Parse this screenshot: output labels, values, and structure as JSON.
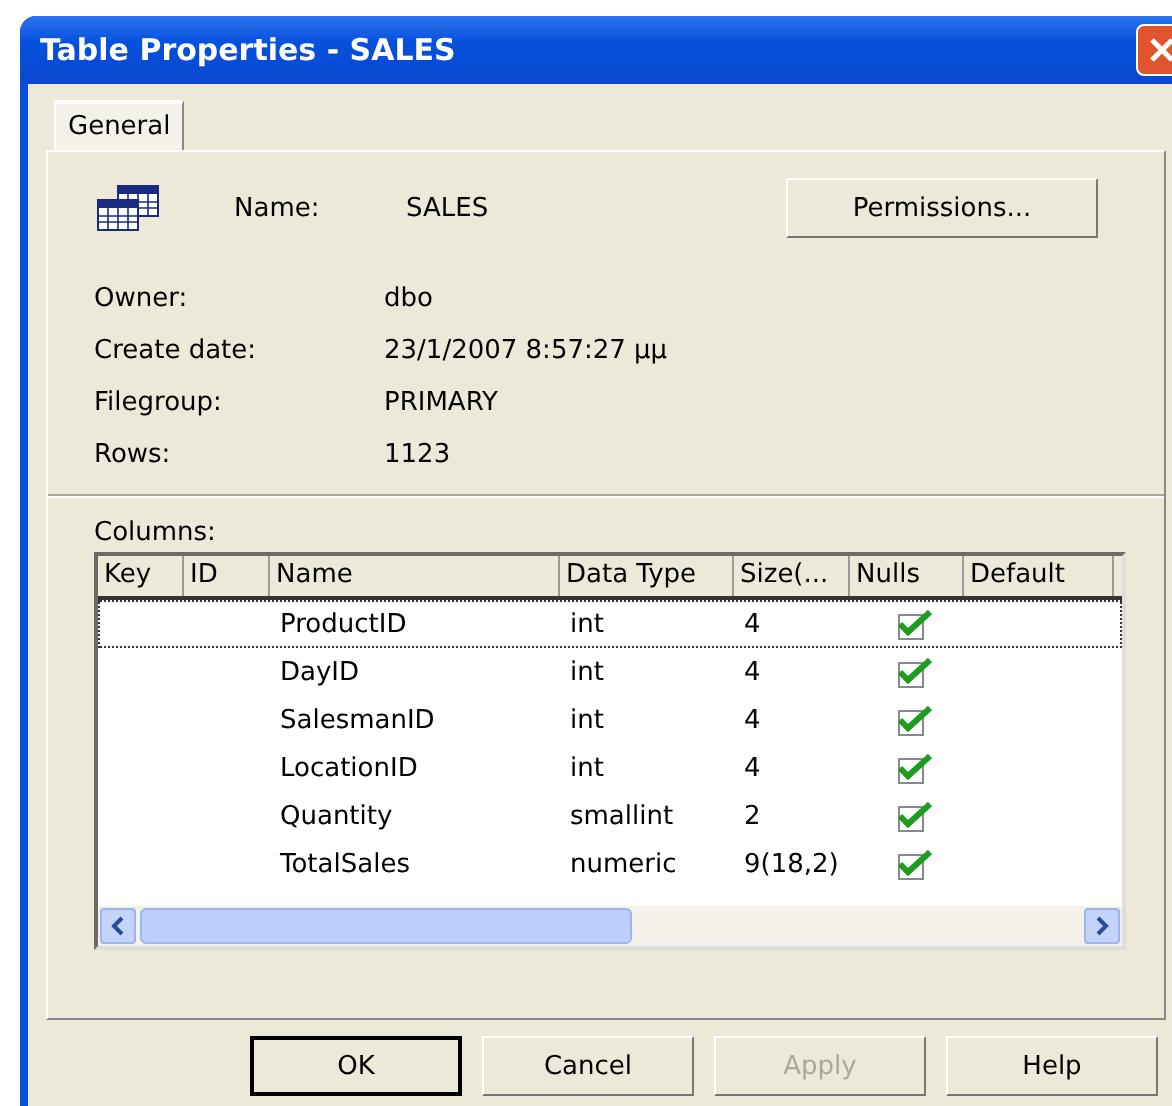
{
  "window": {
    "title": "Table Properties - SALES"
  },
  "tabs": [
    {
      "label": "General",
      "selected": true
    }
  ],
  "name": {
    "label": "Name:",
    "value": "SALES"
  },
  "permissions_button": {
    "label": "Permissions..."
  },
  "properties": [
    {
      "label": "Owner:",
      "value": "dbo"
    },
    {
      "label": "Create date:",
      "value": "23/1/2007 8:57:27 μμ"
    },
    {
      "label": "Filegroup:",
      "value": "PRIMARY"
    },
    {
      "label": "Rows:",
      "value": "1123"
    }
  ],
  "columns_label": "Columns:",
  "table": {
    "columns": [
      "Key",
      "ID",
      "Name",
      "Data Type",
      "Size(...",
      "Nulls",
      "Default"
    ],
    "rows": [
      {
        "name": "ProductID",
        "data_type": "int",
        "size": "4",
        "nulls": true,
        "selected": true
      },
      {
        "name": "DayID",
        "data_type": "int",
        "size": "4",
        "nulls": true,
        "selected": false
      },
      {
        "name": "SalesmanID",
        "data_type": "int",
        "size": "4",
        "nulls": true,
        "selected": false
      },
      {
        "name": "LocationID",
        "data_type": "int",
        "size": "4",
        "nulls": true,
        "selected": false
      },
      {
        "name": "Quantity",
        "data_type": "smallint",
        "size": "2",
        "nulls": true,
        "selected": false
      },
      {
        "name": "TotalSales",
        "data_type": "numeric",
        "size": "9(18,2)",
        "nulls": true,
        "selected": false
      }
    ]
  },
  "buttons": [
    {
      "label": "OK",
      "default": true,
      "disabled": false
    },
    {
      "label": "Cancel",
      "default": false,
      "disabled": false
    },
    {
      "label": "Apply",
      "default": false,
      "disabled": true
    },
    {
      "label": "Help",
      "default": false,
      "disabled": false
    }
  ]
}
